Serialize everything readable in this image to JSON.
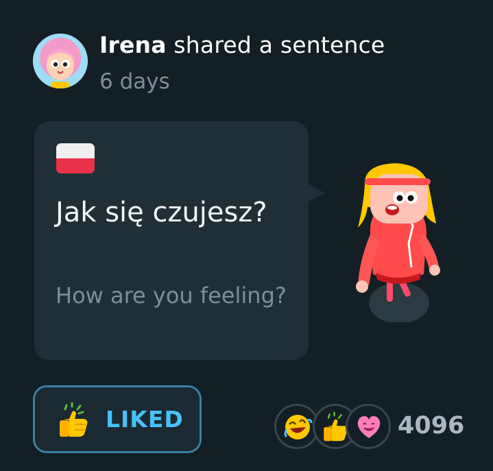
{
  "post": {
    "user_name": "Irena",
    "action_text": " shared a sentence",
    "timestamp": "6 days"
  },
  "sentence": {
    "language_flag": "poland-flag",
    "text": "Jak się czujesz?",
    "translation": "How are you feeling?"
  },
  "like_button": {
    "label": "LIKED",
    "icon": "thumbs-up-icon"
  },
  "reactions": {
    "icons": [
      "laughing-emoji-icon",
      "thumbs-up-icon",
      "heart-face-icon"
    ],
    "count": "4096"
  },
  "colors": {
    "background": "#131f24",
    "card": "#202f36",
    "accent": "#49c0f8",
    "muted": "#7c8f98"
  }
}
